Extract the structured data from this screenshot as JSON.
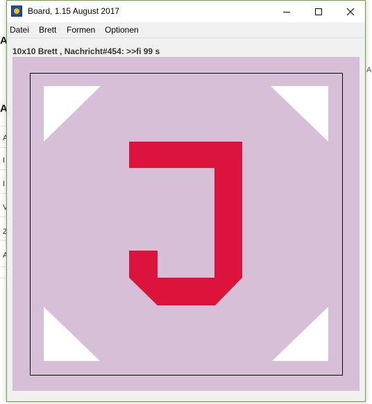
{
  "window": {
    "title": "Board, 1.15 August 2017",
    "minimize_icon": "minimize-icon",
    "maximize_icon": "maximize-icon",
    "close_icon": "close-icon"
  },
  "menu": {
    "datei": "Datei",
    "brett": "Brett",
    "formen": "Formen",
    "optionen": "Optionen"
  },
  "status": {
    "text": "10x10 Brett , Nachricht#454: >>fi 99 s"
  },
  "board": {
    "background_color": "#d8bfd8",
    "frame_color": "#000000",
    "corner_color": "#ffffff",
    "letter_color": "#dc143c",
    "letter": "J"
  },
  "background_app": {
    "letters": [
      "A",
      "A"
    ],
    "fragments": [
      "A",
      "I",
      "I",
      "V",
      "Z",
      "A"
    ],
    "right_fragment": "A"
  }
}
